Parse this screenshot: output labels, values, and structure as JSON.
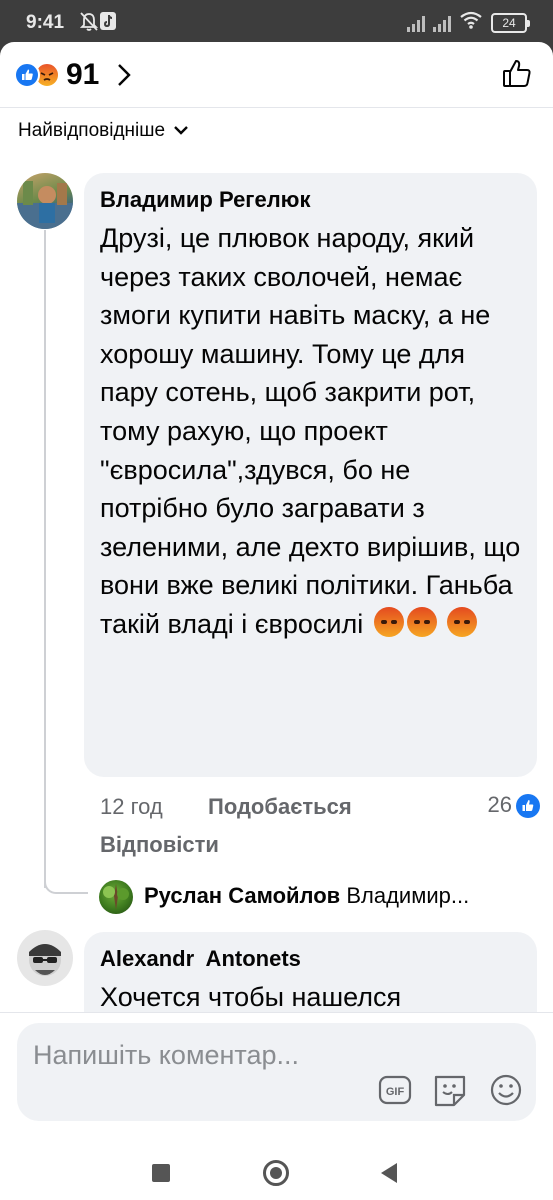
{
  "status_bar": {
    "time": "9:41",
    "battery": "24",
    "icons": [
      "bell-off-icon",
      "tiktok-icon",
      "signal-icon",
      "signal-icon",
      "wifi-icon",
      "battery-icon"
    ]
  },
  "reactions_header": {
    "count": "91",
    "icons": [
      "like-reaction-icon",
      "angry-reaction-icon",
      "chevron-right-icon",
      "thumbs-up-icon"
    ]
  },
  "sort": {
    "label": "Найвідповідніше",
    "icon": "chevron-down-icon"
  },
  "comments": [
    {
      "author": "Владимир Регелюк",
      "text": "Друзі, це плювок народу, який через таких сволочей, немає змоги купити навіть маску, а не хорошу машину. Тому це для пару сотень, щоб закрити рот, тому рахую, що проект \"євросила\",здувся, бо не потрібно було загравати з зеленими, але дехто вирішив, що вони вже великі політики. Ганьба такій владі і євросилі",
      "emoji": [
        "angry-emoji",
        "angry-emoji",
        "angry-emoji"
      ],
      "time": "12 год",
      "like_label": "Подобається",
      "like_count": "26",
      "reply_label": "Відповісти",
      "reply_preview": {
        "author": "Руслан Самойлов",
        "text": "Владимир..."
      }
    },
    {
      "author": "Alexandr  Antonets",
      "text": "Хочется чтобы нашелся"
    }
  ],
  "composer": {
    "placeholder": "Напишіть коментар...",
    "icons": [
      "gif-icon",
      "sticker-icon",
      "emoji-icon"
    ]
  },
  "nav_bar": {
    "icons": [
      "recents-icon",
      "home-icon",
      "back-icon"
    ]
  },
  "colors": {
    "accent": "#1877f2",
    "text": "#050505",
    "secondary_text": "#65676b",
    "bubble": "#f0f2f5",
    "status_bar_bg": "#3d3d3d"
  }
}
